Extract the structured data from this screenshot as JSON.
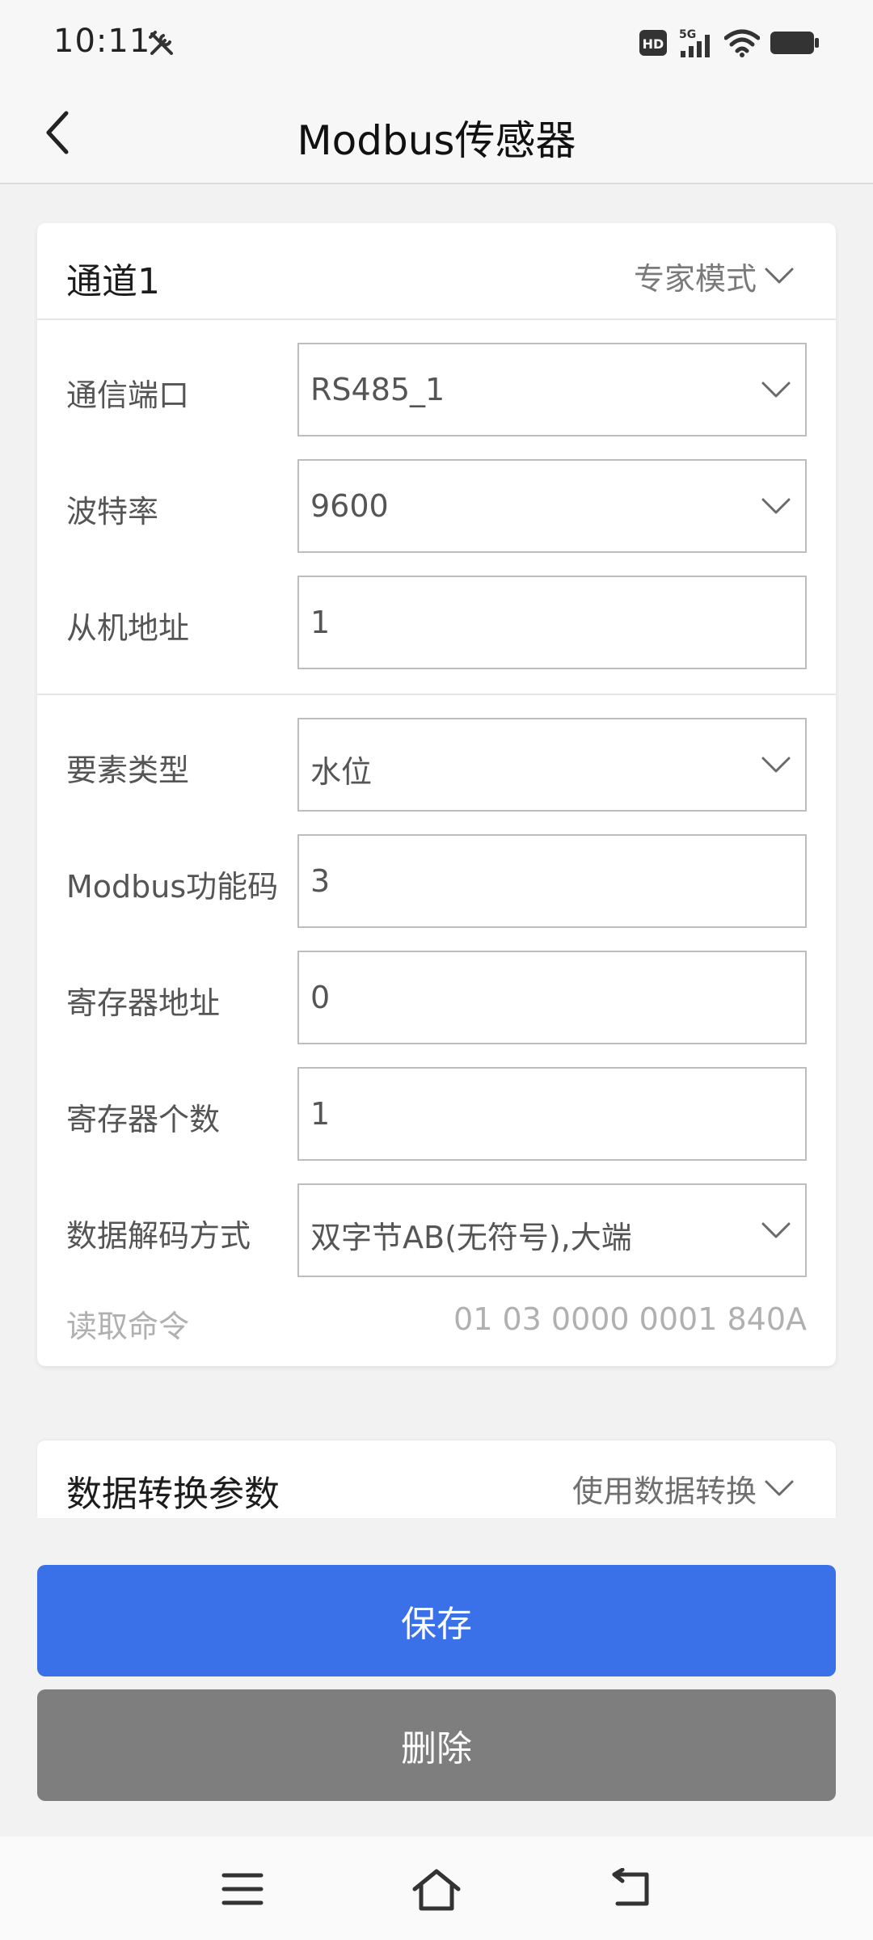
{
  "status_bar": {
    "time": "10:11",
    "tools_icon": "wrench-screwdriver-icon",
    "icons": [
      "hd-icon",
      "signal-5g-icon",
      "wifi-icon",
      "battery-icon"
    ],
    "hd_label": "HD",
    "network_label": "5G"
  },
  "app_bar": {
    "title": "Modbus传感器",
    "back_icon": "back-chevron-icon"
  },
  "channel_card": {
    "title": "通道1",
    "mode_label": "专家模式",
    "fields": {
      "port": {
        "label": "通信端口",
        "value": "RS485_1",
        "dropdown": true
      },
      "baud": {
        "label": "波特率",
        "value": "9600",
        "dropdown": true
      },
      "slave": {
        "label": "从机地址",
        "value": "1",
        "dropdown": false
      },
      "element": {
        "label": "要素类型",
        "value": "水位",
        "dropdown": true
      },
      "func": {
        "label": "Modbus功能码",
        "value": "3",
        "dropdown": false
      },
      "reg_addr": {
        "label": "寄存器地址",
        "value": "0",
        "dropdown": false
      },
      "reg_count": {
        "label": "寄存器个数",
        "value": "1",
        "dropdown": false
      },
      "decode": {
        "label": "数据解码方式",
        "value": "双字节AB(无符号),大端",
        "dropdown": true
      }
    },
    "read_command": {
      "label": "读取命令",
      "value": "01 03 0000 0001 840A"
    }
  },
  "conversion_card": {
    "title": "数据转换参数",
    "action_label": "使用数据转换"
  },
  "buttons": {
    "save": "保存",
    "delete": "删除"
  },
  "nav_bar": {
    "icons": [
      "menu-icon",
      "home-icon",
      "back-icon"
    ]
  },
  "colors": {
    "primary": "#3a71e8",
    "delete": "#7e7e7e",
    "background": "#f2f2f2"
  }
}
